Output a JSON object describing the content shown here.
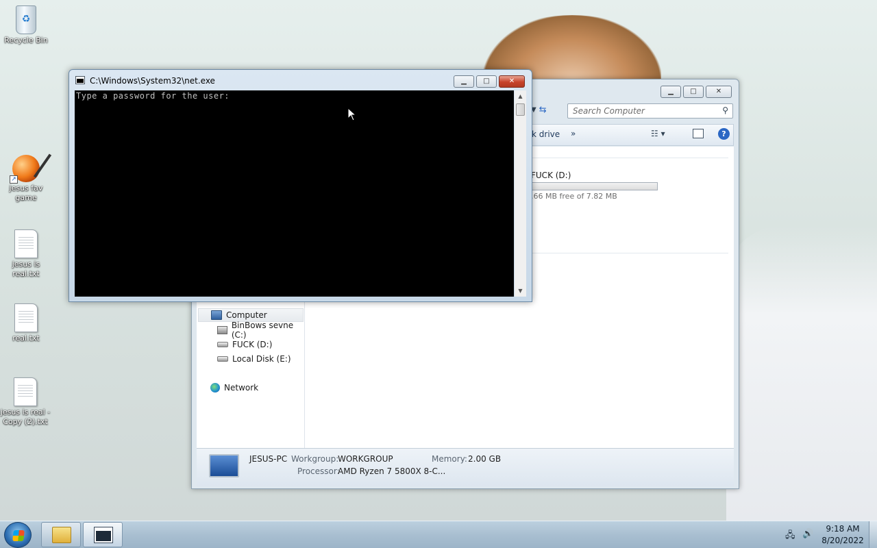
{
  "desktop": {
    "icons": [
      {
        "label": "Recycle Bin",
        "icon": "recycle-bin-icon"
      },
      {
        "label": "jesus fav game",
        "icon": "paint-game-icon"
      },
      {
        "label": "jesus is real.txt",
        "icon": "text-file-icon"
      },
      {
        "label": "real.txt",
        "icon": "text-file-icon"
      },
      {
        "label": "jesus is real - Copy (2).txt",
        "icon": "text-file-icon"
      }
    ]
  },
  "console": {
    "title": "C:\\Windows\\System32\\net.exe",
    "output": "Type a password for the user:",
    "buttons": {
      "minimize": "▁",
      "maximize": "□",
      "close": "✕"
    }
  },
  "explorer": {
    "search_placeholder": "Search Computer",
    "toolbar_partial": "k drive",
    "toolbar_more": "»",
    "drive_partial": {
      "name": "FUCK (D:)",
      "free_text": ".66 MB free of 7.82 MB",
      "used_fraction": 0.0
    },
    "nav": [
      {
        "label": "Computer"
      },
      {
        "label": "BinBows sevne (C:)"
      },
      {
        "label": "FUCK (D:)"
      },
      {
        "label": "Local Disk (E:)"
      },
      {
        "label": "Network"
      }
    ],
    "details": {
      "name": "JESUS-PC",
      "workgroup_label": "Workgroup:",
      "workgroup": "WORKGROUP",
      "memory_label": "Memory:",
      "memory": "2.00 GB",
      "processor_label": "Processor:",
      "processor": "AMD Ryzen 7 5800X 8-C..."
    }
  },
  "taskbar": {
    "time": "9:18 AM",
    "date": "8/20/2022"
  },
  "colors": {
    "console_bg": "#000000",
    "console_text": "#c0c0c0",
    "close_button": "#c7432b",
    "taskbar": "#a9bfd1"
  }
}
